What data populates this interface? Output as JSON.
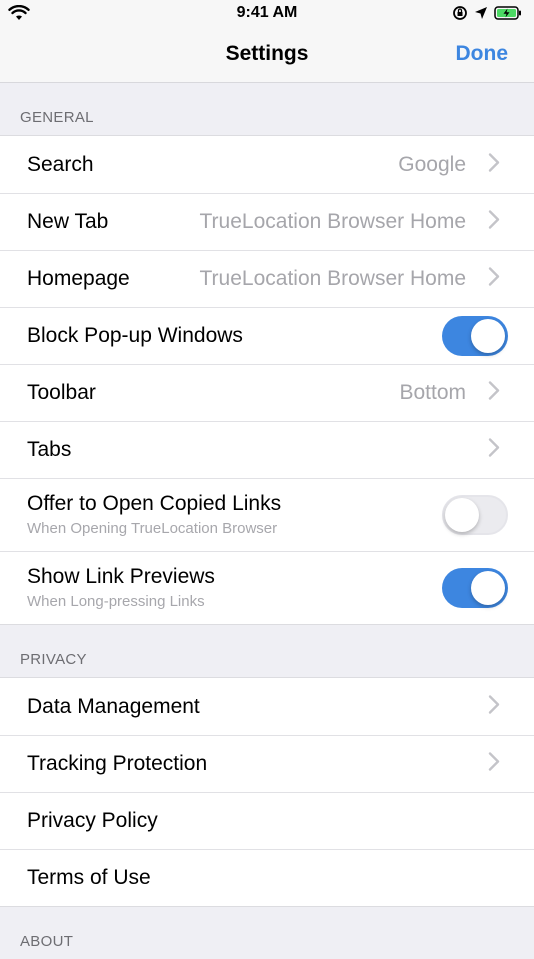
{
  "status_bar": {
    "time": "9:41 AM"
  },
  "nav": {
    "title": "Settings",
    "done_label": "Done"
  },
  "sections": {
    "general": {
      "header": "GENERAL",
      "search": {
        "label": "Search",
        "value": "Google"
      },
      "new_tab": {
        "label": "New Tab",
        "value": "TrueLocation Browser Home"
      },
      "homepage": {
        "label": "Homepage",
        "value": "TrueLocation Browser Home"
      },
      "block_popups": {
        "label": "Block Pop-up Windows",
        "state": "on"
      },
      "toolbar": {
        "label": "Toolbar",
        "value": "Bottom"
      },
      "tabs": {
        "label": "Tabs"
      },
      "offer_links": {
        "label": "Offer to Open Copied Links",
        "sublabel": "When Opening TrueLocation Browser",
        "state": "off"
      },
      "link_previews": {
        "label": "Show Link Previews",
        "sublabel": "When Long-pressing Links",
        "state": "on"
      }
    },
    "privacy": {
      "header": "PRIVACY",
      "data_management": {
        "label": "Data Management"
      },
      "tracking_protection": {
        "label": "Tracking Protection"
      },
      "privacy_policy": {
        "label": "Privacy Policy"
      },
      "terms_of_use": {
        "label": "Terms of Use"
      }
    },
    "about": {
      "header": "ABOUT"
    }
  },
  "colors": {
    "accent": "#3d86e0",
    "background": "#efeff4",
    "secondary_text": "#a6a6ab"
  },
  "icons": [
    "wifi-icon",
    "orientation-lock-icon",
    "location-arrow-icon",
    "battery-charging-icon",
    "chevron-right-icon"
  ]
}
